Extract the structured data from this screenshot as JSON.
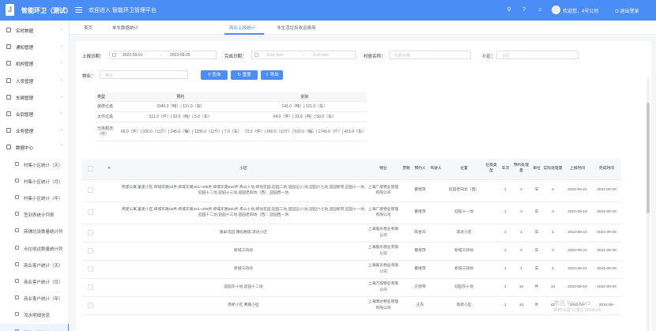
{
  "header": {
    "logo_glyph": "J",
    "app_title": "智能环卫（测试）",
    "welcome": "欢迎进入 智能环卫管理平台",
    "icons": [
      "search-icon",
      "help-icon",
      "bell-icon"
    ],
    "user_name": "欢迎您，4号公司",
    "logout_label": "退出登录",
    "accent_color": "#4a8df6"
  },
  "sidebar": {
    "items": [
      {
        "label": "实时数据",
        "icon": "monitor-icon",
        "arrow": "⌄"
      },
      {
        "label": "通知管理",
        "icon": "bell-icon",
        "arrow": "⌄"
      },
      {
        "label": "机构管理",
        "icon": "org-icon",
        "arrow": "⌄"
      },
      {
        "label": "人员管理",
        "icon": "person-icon",
        "arrow": "⌄"
      },
      {
        "label": "车辆管理",
        "icon": "car-icon",
        "arrow": "⌄"
      },
      {
        "label": "合同管理",
        "icon": "contract-icon",
        "arrow": "⌄"
      },
      {
        "label": "业务管理",
        "icon": "business-icon",
        "arrow": "⌄"
      },
      {
        "label": "数据中心",
        "icon": "data-icon",
        "arrow": "⌃"
      }
    ],
    "subitems": [
      {
        "label": "村集小区统计（天）"
      },
      {
        "label": "村集小区统计（月）"
      },
      {
        "label": "村集小区统计（年）"
      },
      {
        "label": "签到表统计列表"
      },
      {
        "label": "商铺垃圾数量统计列"
      },
      {
        "label": "点位收运数量统计列"
      },
      {
        "label": "商业客户统计（天）"
      },
      {
        "label": "商业客户统计（月）"
      },
      {
        "label": "商业客户统计（年）"
      },
      {
        "label": "流水明细信息"
      },
      {
        "label": "商业上报统计"
      }
    ]
  },
  "tabs": [
    "首页",
    "单车数据统计",
    "商业上报统计",
    "非生活垃圾收运费用"
  ],
  "filters": {
    "report_date_label": "上报日期：",
    "report_date_start": "2022-09-01",
    "report_date_sep": "-",
    "report_date_end": "2022-09-29",
    "complete_date_label": "完成日期：",
    "complete_start_ph": "Start date",
    "complete_end_ph": "End date",
    "village_label": "村居名称：",
    "village_ph": "村居名称",
    "community_label": "小区：",
    "community_ph": "小区",
    "property_label": "物业：",
    "property_ph": "物业",
    "search_btn": "查询",
    "reset_btn": "重置",
    "export_btn": "导出"
  },
  "stats": {
    "headers": [
      "类型",
      "预约",
      "实际"
    ],
    "rows": [
      {
        "type": "装修垃圾",
        "booked": "3340.0（吨）| 121.0（车）",
        "actual": "141.0（吨）| 121.0（车）"
      },
      {
        "type": "大件垃圾",
        "booked": "511.0（件）| 33.0（吨）| 5.0（车）",
        "actual": "64.0（件）| 33.0（吨）| 50.0（车）"
      },
      {
        "type": "分拣粗流（件）",
        "booked": "69.0（件）| 330.0（公斤）| 245.0（桶）| 1206.0（公斤）| 7.0（车）",
        "actual": "72.0（件）| 140.0（公斤）| 522.0（桶）| 1740.0（斤）| 415.0（车）"
      }
    ]
  },
  "table": {
    "headers": [
      "#",
      "小区",
      "物业",
      "普数",
      "预约人",
      "驾驶人",
      "位置",
      "垃圾类型",
      "车次",
      "预约处理量",
      "单位",
      "实际处理量",
      "上报时间",
      "完成时间"
    ],
    "rows": [
      {
        "community": "青建公寓,蓄墨小区,缔城东路55弄,缔城东路491~495弄,缔城东路550弄,青山十坊,缔坊花园,迎园二坊,迎园五/八坊,迎园六七坊,迎园新苑,迎园十一坊,迎园十二坊,迎园十三坊,迎园老四坊（西）,迎园西一坊",
        "property": "上海广厦物业管理有限公司",
        "count": "",
        "booker": "瞿继萍",
        "driver": "",
        "location": "迎园老四坊（西）",
        "type": "",
        "trips": "1",
        "booked_amt": "2",
        "unit": "车",
        "actual_amt": "2",
        "report_time": "2022-09-21",
        "finish_time": "2022-09-29"
      },
      {
        "community": "青建公寓,蓄墨小区,缔城东路55弄,缔城东路491~495弄,缔城东路550弄,青山十坊,缔坊花园,迎园二坊,迎园五/八坊,迎园六七坊,迎园新苑,迎园十一坊,迎园十二坊,迎园十三坊,迎园老四坊（西）,迎园西一坊",
        "property": "上海广厦物业管理有限公司",
        "count": "",
        "booker": "瞿继萍",
        "driver": "",
        "location": "迎园十一坊",
        "type": "",
        "trips": "1",
        "booked_amt": "3",
        "unit": "车",
        "actual_amt": "3",
        "report_time": "2022-09-19",
        "finish_time": "2022-09-29"
      },
      {
        "community": "嘉泰花园,瑞虹路级,浑达小区",
        "property": "上海嘉乐物业有限公司",
        "count": "",
        "booker": "陈金华",
        "driver": "",
        "location": "浑达小区",
        "type": "",
        "trips": "1",
        "booked_amt": "1",
        "unit": "车",
        "actual_amt": "1",
        "report_time": "2022-09-22",
        "finish_time": "2022-09-29"
      },
      {
        "community": "新城三四坊",
        "property": "上海嘉乐物业有限公司",
        "count": "",
        "booker": "瞿继萍",
        "driver": "",
        "location": "新城三四坊",
        "type": "",
        "trips": "1",
        "booked_amt": "2",
        "unit": "车",
        "actual_amt": "2",
        "report_time": "2022-09-21",
        "finish_time": "2022-09-29"
      },
      {
        "community": "新城三四坊",
        "property": "上海嘉乐物业有限公司",
        "count": "",
        "booker": "瞿继萍",
        "driver": "",
        "location": "新城三四坊",
        "type": "",
        "trips": "1",
        "booked_amt": "1",
        "unit": "车",
        "actual_amt": "1",
        "report_time": "2022-09-21",
        "finish_time": "2022-09-29"
      },
      {
        "community": "迎园东十坊,迎园十二坊",
        "property": "上海万得物业有限公司",
        "count": "",
        "booker": "方丽琴",
        "driver": "",
        "location": "迎园东十坊",
        "type": "",
        "trips": "1",
        "booked_amt": "10",
        "unit": "件",
        "actual_amt": "10",
        "report_time": "2022-09-19",
        "finish_time": "2022-09-29"
      },
      {
        "community": "南新小区,黄路小区",
        "property": "上海明达物业管理有限公司",
        "count": "",
        "booker": "王东",
        "driver": "",
        "location": "南新小区",
        "type": "",
        "trips": "1",
        "booked_amt": "10",
        "unit": "件",
        "actual_amt": "42",
        "report_time": "2022-09-",
        "finish_time": "2022-09-"
      }
    ]
  },
  "watermark": {
    "line1": "激活 Windows",
    "line2": "转到\"设置\"以激活 Windows。"
  }
}
